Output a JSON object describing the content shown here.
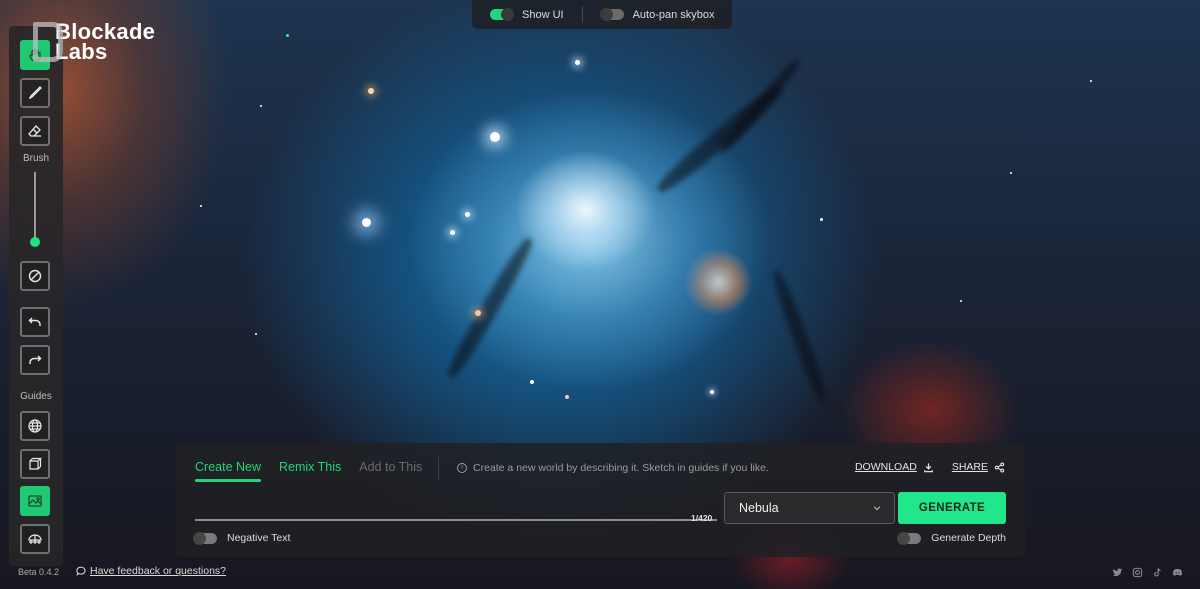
{
  "app": {
    "brand_line1": "Blockade",
    "brand_line2": "Labs",
    "version": "Beta 0.4.2",
    "feedback_link": "Have feedback or questions?"
  },
  "top_bar": {
    "toggles": [
      {
        "label": "Show UI",
        "on": true
      },
      {
        "label": "Auto-pan skybox",
        "on": false
      }
    ]
  },
  "toolbar": {
    "tools": [
      {
        "name": "pan-hand",
        "active": true
      },
      {
        "name": "brush",
        "active": false
      },
      {
        "name": "eraser",
        "active": false
      }
    ],
    "brush_label": "Brush",
    "brush_size": 0.05,
    "clear_icon": "no-entry",
    "undo_icon": "undo",
    "redo_icon": "redo",
    "guides_label": "Guides",
    "guides": [
      {
        "name": "globe-guide",
        "active": false
      },
      {
        "name": "cube-guide",
        "active": false
      },
      {
        "name": "image-guide",
        "active": true
      },
      {
        "name": "dome-guide",
        "active": false
      }
    ]
  },
  "panel": {
    "tabs": [
      {
        "label": "Create New",
        "state": "active"
      },
      {
        "label": "Remix This",
        "state": "enabled"
      },
      {
        "label": "Add to This",
        "state": "disabled"
      }
    ],
    "hint": "Create a new world by describing it. Sketch in guides if you like.",
    "download_label": "DOWNLOAD",
    "share_label": "SHARE",
    "prompt_value": "",
    "prompt_placeholder": "",
    "char_count": "1/420",
    "style_selected": "Nebula",
    "generate_label": "GENERATE",
    "negative_text_label": "Negative Text",
    "negative_text_on": false,
    "generate_depth_label": "Generate Depth",
    "generate_depth_on": false
  },
  "socials": [
    "twitter-icon",
    "instagram-icon",
    "tiktok-icon",
    "discord-icon"
  ],
  "colors": {
    "accent": "#22d47a",
    "generate_bg": "#22e68c",
    "panel_bg": "#202124",
    "disabled_tab": "#6a6a6a"
  }
}
